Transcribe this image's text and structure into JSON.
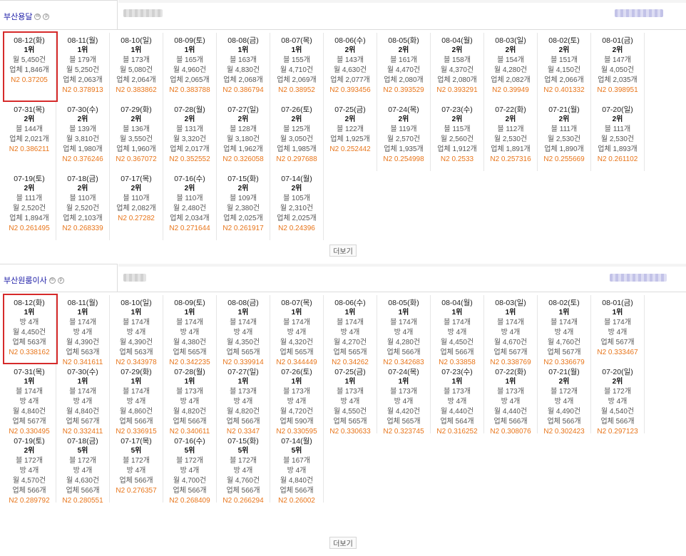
{
  "sections": [
    {
      "keyword": "부산용달",
      "more": "더보기",
      "rows": [
        [
          {
            "date": "08-12(화)",
            "rank": "1위",
            "lines": [
              "월 5,450건",
              "업체 1,846개"
            ],
            "n2": "N2 0.37205",
            "highlight": true
          },
          {
            "date": "08-11(월)",
            "rank": "1위",
            "lines": [
              "블 179개",
              "월 5,250건",
              "업체 2,063개"
            ],
            "n2": "N2 0.378913"
          },
          {
            "date": "08-10(일)",
            "rank": "1위",
            "lines": [
              "블 173개",
              "월 5,080건",
              "업체 2,064개"
            ],
            "n2": "N2 0.383862"
          },
          {
            "date": "08-09(토)",
            "rank": "1위",
            "lines": [
              "블 165개",
              "월 4,960건",
              "업체 2,065개"
            ],
            "n2": "N2 0.383788"
          },
          {
            "date": "08-08(금)",
            "rank": "1위",
            "lines": [
              "블 163개",
              "월 4,830건",
              "업체 2,068개"
            ],
            "n2": "N2 0.386794"
          },
          {
            "date": "08-07(목)",
            "rank": "1위",
            "lines": [
              "블 155개",
              "월 4,710건",
              "업체 2,069개"
            ],
            "n2": "N2 0.38952"
          },
          {
            "date": "08-06(수)",
            "rank": "2위",
            "lines": [
              "블 143개",
              "월 4,630건",
              "업체 2,077개"
            ],
            "n2": "N2 0.393456"
          },
          {
            "date": "08-05(화)",
            "rank": "2위",
            "lines": [
              "블 161개",
              "월 4,470건",
              "업체 2,080개"
            ],
            "n2": "N2 0.393529"
          },
          {
            "date": "08-04(월)",
            "rank": "2위",
            "lines": [
              "블 158개",
              "월 4,370건",
              "업체 2,080개"
            ],
            "n2": "N2 0.393291"
          },
          {
            "date": "08-03(일)",
            "rank": "2위",
            "lines": [
              "블 154개",
              "월 4,280건",
              "업체 2,082개"
            ],
            "n2": "N2 0.39949"
          },
          {
            "date": "08-02(토)",
            "rank": "2위",
            "lines": [
              "블 151개",
              "월 4,150건",
              "업체 2,066개"
            ],
            "n2": "N2 0.401332"
          },
          {
            "date": "08-01(금)",
            "rank": "2위",
            "lines": [
              "블 147개",
              "월 4,050건",
              "업체 2,035개"
            ],
            "n2": "N2 0.398951"
          }
        ],
        [
          {
            "date": "07-31(목)",
            "rank": "2위",
            "lines": [
              "블 144개",
              "업체 2,021개"
            ],
            "n2": "N2 0.386211"
          },
          {
            "date": "07-30(수)",
            "rank": "2위",
            "lines": [
              "블 139개",
              "월 3,810건",
              "업체 1,980개"
            ],
            "n2": "N2 0.376246"
          },
          {
            "date": "07-29(화)",
            "rank": "2위",
            "lines": [
              "블 136개",
              "월 3,550건",
              "업체 1,960개"
            ],
            "n2": "N2 0.367072"
          },
          {
            "date": "07-28(월)",
            "rank": "2위",
            "lines": [
              "블 131개",
              "월 3,320건",
              "업체 2,017개"
            ],
            "n2": "N2 0.352552"
          },
          {
            "date": "07-27(일)",
            "rank": "2위",
            "lines": [
              "블 128개",
              "월 3,180건",
              "업체 1,962개"
            ],
            "n2": "N2 0.326058"
          },
          {
            "date": "07-26(토)",
            "rank": "2위",
            "lines": [
              "블 125개",
              "월 3,050건",
              "업체 1,985개"
            ],
            "n2": "N2 0.297688"
          },
          {
            "date": "07-25(금)",
            "rank": "2위",
            "lines": [
              "블 122개",
              "업체 1,925개"
            ],
            "n2": "N2 0.252442"
          },
          {
            "date": "07-24(목)",
            "rank": "2위",
            "lines": [
              "블 119개",
              "월 2,570건",
              "업체 1,935개"
            ],
            "n2": "N2 0.254998"
          },
          {
            "date": "07-23(수)",
            "rank": "2위",
            "lines": [
              "블 115개",
              "월 2,560건",
              "업체 1,912개"
            ],
            "n2": "N2 0.2533"
          },
          {
            "date": "07-22(화)",
            "rank": "2위",
            "lines": [
              "블 112개",
              "월 2,530건",
              "업체 1,891개"
            ],
            "n2": "N2 0.257316"
          },
          {
            "date": "07-21(월)",
            "rank": "2위",
            "lines": [
              "블 111개",
              "월 2,530건",
              "업체 1,890개"
            ],
            "n2": "N2 0.255669"
          },
          {
            "date": "07-20(일)",
            "rank": "2위",
            "lines": [
              "블 111개",
              "월 2,530건",
              "업체 1,893개"
            ],
            "n2": "N2 0.261102"
          }
        ],
        [
          {
            "date": "07-19(토)",
            "rank": "2위",
            "lines": [
              "블 111개",
              "월 2,520건",
              "업체 1,894개"
            ],
            "n2": "N2 0.261495"
          },
          {
            "date": "07-18(금)",
            "rank": "2위",
            "lines": [
              "블 110개",
              "월 2,520건",
              "업체 2,103개"
            ],
            "n2": "N2 0.268339"
          },
          {
            "date": "07-17(목)",
            "rank": "2위",
            "lines": [
              "블 110개",
              "업체 2,082개"
            ],
            "n2": "N2 0.27282"
          },
          {
            "date": "07-16(수)",
            "rank": "2위",
            "lines": [
              "블 110개",
              "월 2,480건",
              "업체 2,034개"
            ],
            "n2": "N2 0.271644"
          },
          {
            "date": "07-15(화)",
            "rank": "2위",
            "lines": [
              "블 109개",
              "월 2,380건",
              "업체 2,025개"
            ],
            "n2": "N2 0.261917"
          },
          {
            "date": "07-14(월)",
            "rank": "2위",
            "lines": [
              "블 105개",
              "월 2,310건",
              "업체 2,025개"
            ],
            "n2": "N2 0.24396"
          }
        ]
      ]
    },
    {
      "keyword": "부산원룸이사",
      "more": "더보기",
      "rows": [
        [
          {
            "date": "08-12(화)",
            "rank": "1위",
            "lines": [
              "방 4개",
              "월 4,450건",
              "업체 563개"
            ],
            "n2": "N2 0.338162",
            "highlight": true
          },
          {
            "date": "08-11(월)",
            "rank": "1위",
            "lines": [
              "블 174개",
              "방 4개",
              "월 4,390건",
              "업체 563개"
            ],
            "n2": "N2 0.341611"
          },
          {
            "date": "08-10(일)",
            "rank": "1위",
            "lines": [
              "블 174개",
              "방 4개",
              "월 4,390건",
              "업체 563개"
            ],
            "n2": "N2 0.343978"
          },
          {
            "date": "08-09(토)",
            "rank": "1위",
            "lines": [
              "블 174개",
              "방 4개",
              "월 4,380건",
              "업체 565개"
            ],
            "n2": "N2 0.342235"
          },
          {
            "date": "08-08(금)",
            "rank": "1위",
            "lines": [
              "블 174개",
              "방 4개",
              "월 4,350건",
              "업체 565개"
            ],
            "n2": "N2 0.339914"
          },
          {
            "date": "08-07(목)",
            "rank": "1위",
            "lines": [
              "블 174개",
              "방 4개",
              "월 4,320건",
              "업체 565개"
            ],
            "n2": "N2 0.344449"
          },
          {
            "date": "08-06(수)",
            "rank": "1위",
            "lines": [
              "블 174개",
              "방 4개",
              "월 4,270건",
              "업체 565개"
            ],
            "n2": "N2 0.34262"
          },
          {
            "date": "08-05(화)",
            "rank": "1위",
            "lines": [
              "블 174개",
              "방 4개",
              "월 4,280건",
              "업체 566개"
            ],
            "n2": "N2 0.342683"
          },
          {
            "date": "08-04(월)",
            "rank": "1위",
            "lines": [
              "블 174개",
              "방 4개",
              "월 4,450건",
              "업체 566개"
            ],
            "n2": "N2 0.33858"
          },
          {
            "date": "08-03(일)",
            "rank": "1위",
            "lines": [
              "블 174개",
              "방 4개",
              "월 4,670건",
              "업체 567개"
            ],
            "n2": "N2 0.338769"
          },
          {
            "date": "08-02(토)",
            "rank": "1위",
            "lines": [
              "블 174개",
              "방 4개",
              "월 4,760건",
              "업체 567개"
            ],
            "n2": "N2 0.336679"
          },
          {
            "date": "08-01(금)",
            "rank": "1위",
            "lines": [
              "블 174개",
              "방 4개",
              "업체 567개"
            ],
            "n2": "N2 0.333467"
          }
        ],
        [
          {
            "date": "07-31(목)",
            "rank": "1위",
            "lines": [
              "블 174개",
              "방 4개",
              "월 4,840건",
              "업체 567개"
            ],
            "n2": "N2 0.330495"
          },
          {
            "date": "07-30(수)",
            "rank": "1위",
            "lines": [
              "블 174개",
              "방 4개",
              "월 4,840건",
              "업체 567개"
            ],
            "n2": "N2 0.332411"
          },
          {
            "date": "07-29(화)",
            "rank": "1위",
            "lines": [
              "블 174개",
              "방 4개",
              "월 4,860건",
              "업체 566개"
            ],
            "n2": "N2 0.336915"
          },
          {
            "date": "07-28(월)",
            "rank": "1위",
            "lines": [
              "블 173개",
              "방 4개",
              "월 4,820건",
              "업체 566개"
            ],
            "n2": "N2 0.340611"
          },
          {
            "date": "07-27(일)",
            "rank": "1위",
            "lines": [
              "블 173개",
              "방 4개",
              "월 4,820건",
              "업체 566개"
            ],
            "n2": "N2 0.3347"
          },
          {
            "date": "07-26(토)",
            "rank": "1위",
            "lines": [
              "블 173개",
              "방 4개",
              "월 4,720건",
              "업체 590개"
            ],
            "n2": "N2 0.330595"
          },
          {
            "date": "07-25(금)",
            "rank": "1위",
            "lines": [
              "블 173개",
              "방 4개",
              "월 4,550건",
              "업체 565개"
            ],
            "n2": "N2 0.330633"
          },
          {
            "date": "07-24(목)",
            "rank": "1위",
            "lines": [
              "블 173개",
              "방 4개",
              "월 4,420건",
              "업체 565개"
            ],
            "n2": "N2 0.323745"
          },
          {
            "date": "07-23(수)",
            "rank": "1위",
            "lines": [
              "블 173개",
              "방 4개",
              "월 4,440건",
              "업체 564개"
            ],
            "n2": "N2 0.316252"
          },
          {
            "date": "07-22(화)",
            "rank": "1위",
            "lines": [
              "블 173개",
              "방 4개",
              "월 4,440건",
              "업체 566개"
            ],
            "n2": "N2 0.308076"
          },
          {
            "date": "07-21(월)",
            "rank": "2위",
            "lines": [
              "블 172개",
              "방 4개",
              "월 4,490건",
              "업체 566개"
            ],
            "n2": "N2 0.302423"
          },
          {
            "date": "07-20(일)",
            "rank": "2위",
            "lines": [
              "블 172개",
              "방 4개",
              "월 4,540건",
              "업체 566개"
            ],
            "n2": "N2 0.297123"
          }
        ],
        [
          {
            "date": "07-19(토)",
            "rank": "2위",
            "lines": [
              "블 172개",
              "방 4개",
              "월 4,570건",
              "업체 566개"
            ],
            "n2": "N2 0.289792"
          },
          {
            "date": "07-18(금)",
            "rank": "5위",
            "lines": [
              "블 172개",
              "방 4개",
              "월 4,630건",
              "업체 566개"
            ],
            "n2": "N2 0.280551"
          },
          {
            "date": "07-17(목)",
            "rank": "5위",
            "lines": [
              "블 172개",
              "방 4개",
              "업체 566개"
            ],
            "n2": "N2 0.276357"
          },
          {
            "date": "07-16(수)",
            "rank": "5위",
            "lines": [
              "블 172개",
              "방 4개",
              "월 4,700건",
              "업체 566개"
            ],
            "n2": "N2 0.268409"
          },
          {
            "date": "07-15(화)",
            "rank": "5위",
            "lines": [
              "블 172개",
              "방 4개",
              "월 4,760건",
              "업체 566개"
            ],
            "n2": "N2 0.266294"
          },
          {
            "date": "07-14(월)",
            "rank": "5위",
            "lines": [
              "블 167개",
              "방 4개",
              "월 4,840건",
              "업체 566개"
            ],
            "n2": "N2 0.26002"
          }
        ]
      ]
    }
  ]
}
